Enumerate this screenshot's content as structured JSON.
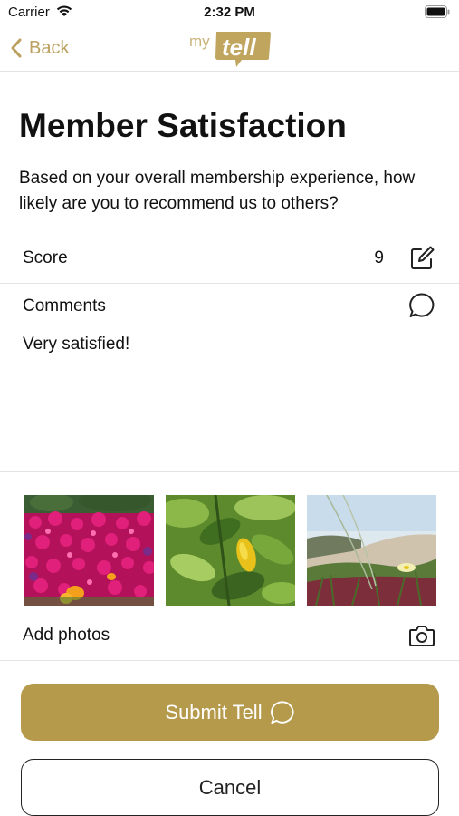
{
  "status_bar": {
    "carrier": "Carrier",
    "time": "2:32 PM"
  },
  "nav": {
    "back_label": "Back",
    "logo_text_my": "my",
    "logo_text_tell": "tell",
    "accent_color": "#bca060"
  },
  "survey": {
    "title": "Member Satisfaction",
    "question": "Based on your overall membership experience, how likely are you to recommend us to others?",
    "score_label": "Score",
    "score_value": "9",
    "comments_label": "Comments",
    "comment_text": "Very satisfied!"
  },
  "photos": {
    "items": [
      {
        "name": "pink-flowers-photo"
      },
      {
        "name": "lemon-leaves-photo"
      },
      {
        "name": "beach-dunes-photo"
      }
    ],
    "add_label": "Add photos"
  },
  "actions": {
    "submit_label": "Submit Tell",
    "cancel_label": "Cancel",
    "submit_color": "#b69a4c"
  }
}
